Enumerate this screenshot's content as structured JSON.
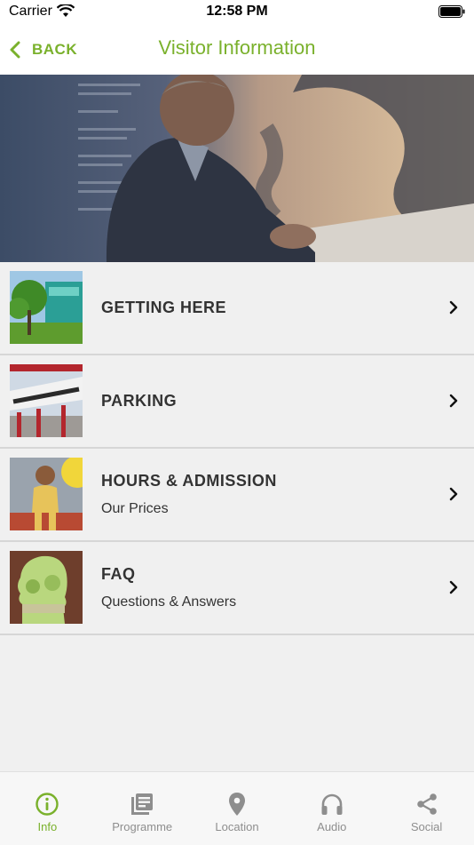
{
  "status": {
    "carrier": "Carrier",
    "time": "12:58 PM"
  },
  "nav": {
    "back_label": "BACK",
    "title": "Visitor Information"
  },
  "menu": [
    {
      "title": "GETTING HERE",
      "subtitle": ""
    },
    {
      "title": "PARKING",
      "subtitle": ""
    },
    {
      "title": "HOURS & ADMISSION",
      "subtitle": "Our Prices"
    },
    {
      "title": "FAQ",
      "subtitle": "Questions & Answers"
    }
  ],
  "tabs": [
    {
      "label": "Info",
      "icon": "info-icon",
      "active": true
    },
    {
      "label": "Programme",
      "icon": "programme-icon",
      "active": false
    },
    {
      "label": "Location",
      "icon": "location-pin-icon",
      "active": false
    },
    {
      "label": "Audio",
      "icon": "headphones-icon",
      "active": false
    },
    {
      "label": "Social",
      "icon": "share-icon",
      "active": false
    }
  ],
  "colors": {
    "accent": "#7ab12c",
    "inactive_tab": "#8e8e8e",
    "background": "#f0f0f0"
  }
}
